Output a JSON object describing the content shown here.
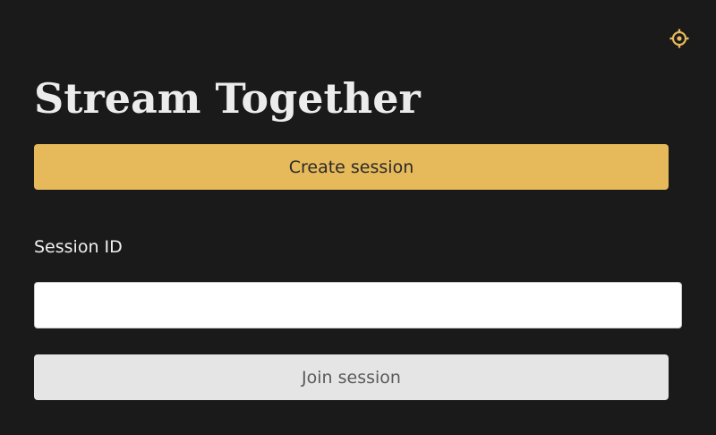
{
  "header": {
    "settings_icon": "gear-icon",
    "title": "Stream Together"
  },
  "create": {
    "label": "Create session"
  },
  "session": {
    "label": "Session ID",
    "value": "",
    "placeholder": ""
  },
  "join": {
    "label": "Join session"
  },
  "colors": {
    "background": "#1a1a1a",
    "accent": "#e6b95a",
    "secondary_button": "#e5e5e5"
  }
}
